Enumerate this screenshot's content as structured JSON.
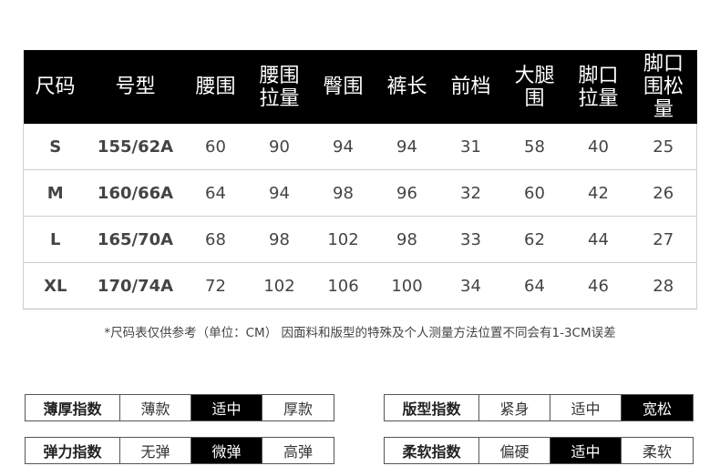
{
  "table": {
    "headers": [
      "尺码",
      "号型",
      "腰围",
      "腰围\n拉量",
      "臀围",
      "裤长",
      "前档",
      "大腿\n围",
      "脚口\n拉量",
      "脚口\n围松\n量"
    ],
    "rows": [
      [
        "S",
        "155/62A",
        "60",
        "90",
        "94",
        "94",
        "31",
        "58",
        "40",
        "25"
      ],
      [
        "M",
        "160/66A",
        "64",
        "94",
        "98",
        "96",
        "32",
        "60",
        "42",
        "26"
      ],
      [
        "L",
        "165/70A",
        "68",
        "98",
        "102",
        "98",
        "33",
        "62",
        "44",
        "27"
      ],
      [
        "XL",
        "170/74A",
        "72",
        "102",
        "106",
        "100",
        "34",
        "64",
        "46",
        "28"
      ]
    ]
  },
  "note": "*尺码表仅供参考（单位：CM） 因面料和版型的特殊及个人测量方法位置不同会有1-3CM误差",
  "indices": {
    "thickness": {
      "label": "薄厚指数",
      "options": [
        "薄款",
        "适中",
        "厚款"
      ],
      "selected": "适中"
    },
    "fit": {
      "label": "版型指数",
      "options": [
        "紧身",
        "适中",
        "宽松"
      ],
      "selected": "宽松"
    },
    "elasticity": {
      "label": "弹力指数",
      "options": [
        "无弹",
        "微弹",
        "高弹"
      ],
      "selected": "微弹"
    },
    "softness": {
      "label": "柔软指数",
      "options": [
        "偏硬",
        "适中",
        "柔软"
      ],
      "selected": "适中"
    }
  }
}
